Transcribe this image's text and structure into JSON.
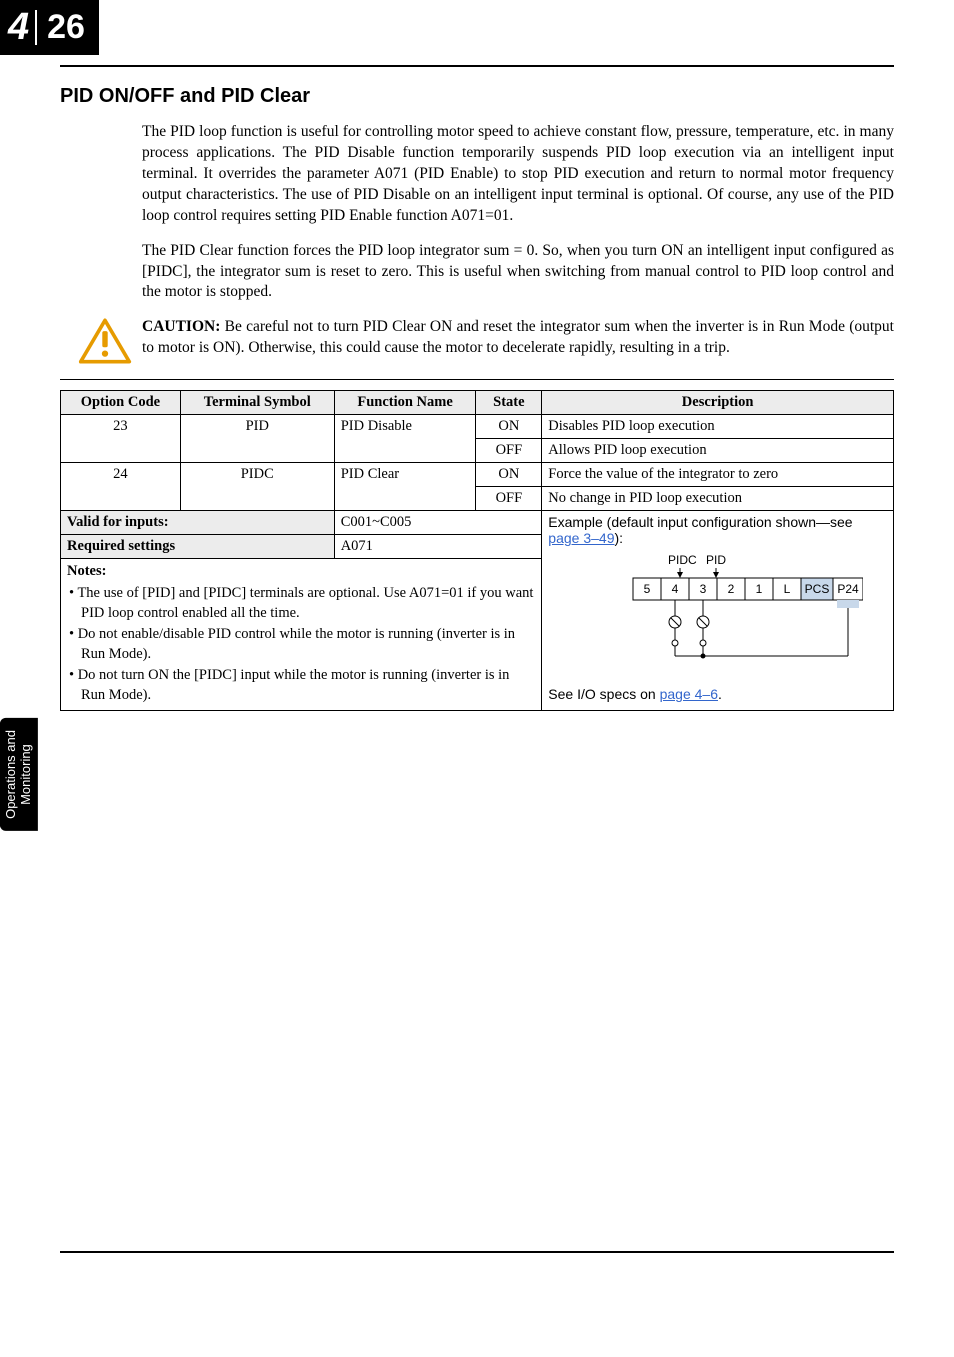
{
  "page": {
    "chapter": "4",
    "number": "26",
    "side_tab": "Operations and\nMonitoring"
  },
  "section": {
    "title": "PID ON/OFF and PID Clear",
    "para1": "The PID loop function is useful for controlling motor speed to achieve constant flow, pressure, temperature, etc. in many process applications. The PID Disable function temporarily suspends PID loop execution via an intelligent input terminal. It overrides the parameter A071 (PID Enable) to stop PID execution and return to normal motor frequency output characteristics. The use of PID Disable on an intelligent input terminal is optional. Of course, any use of the PID loop control requires setting PID Enable function A071=01.",
    "para2": "The PID Clear function forces the PID loop integrator sum = 0. So, when you turn ON an intelligent input configured as [PIDC], the integrator sum is reset to zero. This is useful when switching from manual control to PID loop control and the motor is stopped."
  },
  "caution": {
    "label": "CAUTION:",
    "text": " Be careful not to turn PID Clear ON and reset the integrator sum when the inverter is in Run Mode (output to motor is ON). Otherwise, this could cause the motor to decelerate rapidly, resulting in a trip."
  },
  "table": {
    "headers": {
      "option_code": "Option Code",
      "terminal_symbol": "Terminal Symbol",
      "function_name": "Function Name",
      "state": "State",
      "description": "Description"
    },
    "rows": [
      {
        "code": "23",
        "symbol": "PID",
        "func": "PID Disable",
        "state": "ON",
        "desc": "Disables PID loop execution"
      },
      {
        "code": "",
        "symbol": "",
        "func": "",
        "state": "OFF",
        "desc": "Allows PID loop execution"
      },
      {
        "code": "24",
        "symbol": "PIDC",
        "func": "PID Clear",
        "state": "ON",
        "desc": "Force the value of the integrator to zero"
      },
      {
        "code": "",
        "symbol": "",
        "func": "",
        "state": "OFF",
        "desc": "No change in PID loop execution"
      }
    ],
    "valid_inputs_label": "Valid for inputs:",
    "valid_inputs_value": "C001~C005",
    "required_settings_label": "Required settings",
    "required_settings_value": "A071",
    "example_label": "Example (default input configuration shown—see ",
    "example_link": "page 3–49",
    "example_after": "):",
    "iospec_label": "See I/O specs on ",
    "iospec_link": "page 4–6",
    "iospec_after": ".",
    "notes_title": "Notes:",
    "notes": [
      "The use of [PID] and [PIDC] terminals are optional. Use A071=01 if you want PID loop control enabled all the time.",
      "Do not enable/disable PID control while the motor is running (inverter is in Run Mode).",
      "Do not turn ON the [PIDC] input while the motor is running (inverter is in Run Mode)."
    ]
  },
  "diagram": {
    "label_pidc": "PIDC",
    "label_pid": "PID",
    "terminals": [
      "5",
      "4",
      "3",
      "2",
      "1",
      "L",
      "PCS",
      "P24"
    ]
  }
}
